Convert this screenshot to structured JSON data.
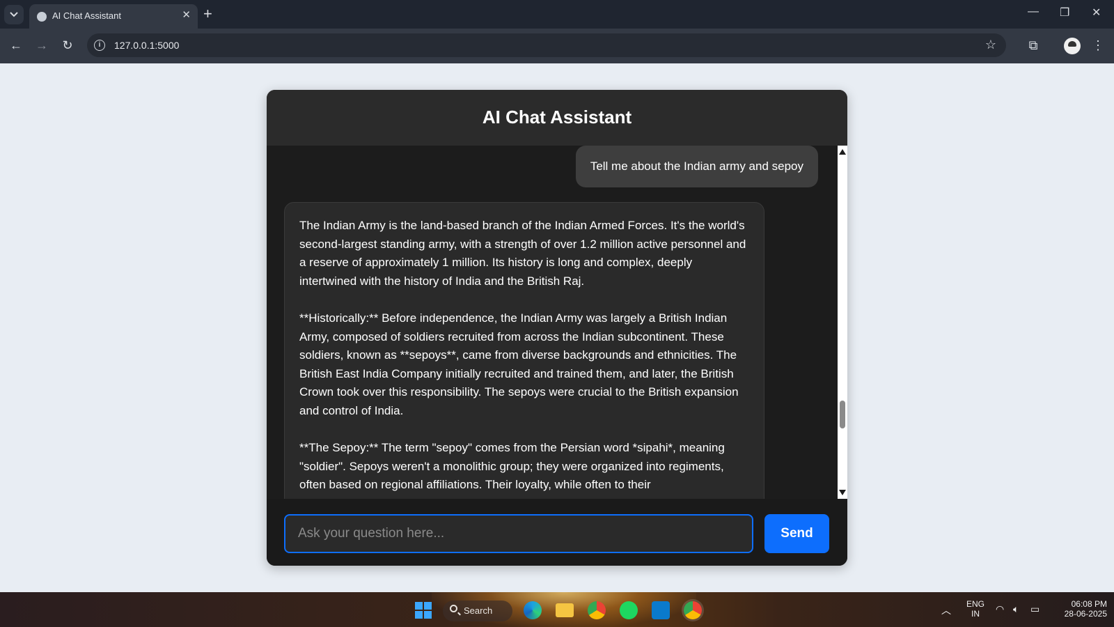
{
  "browser": {
    "tab_title": "AI Chat Assistant",
    "url": "127.0.0.1:5000"
  },
  "chat": {
    "title": "AI Chat Assistant",
    "user_message": "Tell me about the Indian army and sepoy",
    "bot_paragraphs": [
      "The Indian Army is the land-based branch of the Indian Armed Forces. It's the world's second-largest standing army, with a strength of over 1.2 million active personnel and a reserve of approximately 1 million. Its history is long and complex, deeply intertwined with the history of India and the British Raj.",
      "**Historically:** Before independence, the Indian Army was largely a British Indian Army, composed of soldiers recruited from across the Indian subcontinent. These soldiers, known as **sepoys**, came from diverse backgrounds and ethnicities. The British East India Company initially recruited and trained them, and later, the British Crown took over this responsibility. The sepoys were crucial to the British expansion and control of India.",
      "**The Sepoy:** The term \"sepoy\" comes from the Persian word *sipahi*, meaning \"soldier\". Sepoys weren't a monolithic group; they were organized into regiments, often based on regional affiliations. Their loyalty, while often to their"
    ],
    "input_placeholder": "Ask your question here...",
    "send_label": "Send"
  },
  "taskbar": {
    "search_label": "Search",
    "language": "ENG",
    "region": "IN",
    "time": "06:08 PM",
    "date": "28-06-2025"
  },
  "colors": {
    "accent": "#0d6efd",
    "card_bg": "#1c1c1c",
    "header_bg": "#2b2b2b",
    "user_bubble": "#3e3e3e",
    "bot_bubble": "#2a2a2a"
  }
}
